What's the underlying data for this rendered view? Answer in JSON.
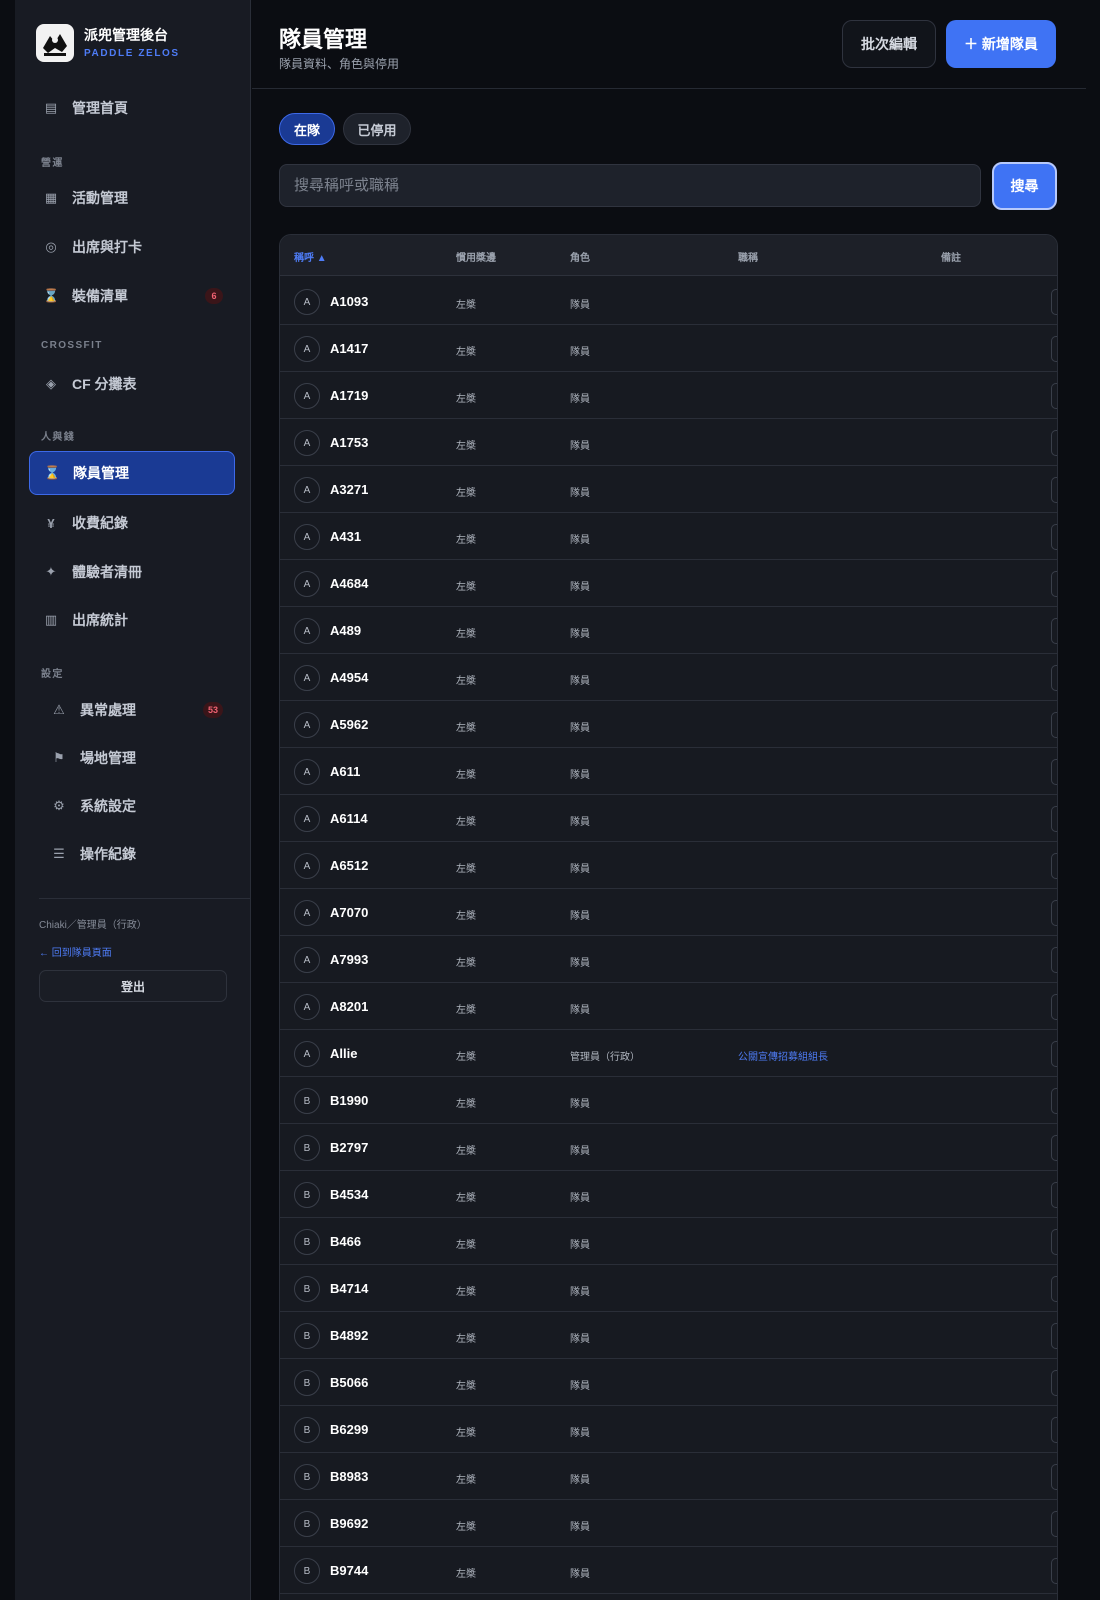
{
  "brand": {
    "title": "派兜管理後台",
    "subtitle": "PADDLE ZELOS"
  },
  "sidebar": {
    "home": {
      "label": "管理首頁",
      "icon": "list-icon"
    },
    "sections": {
      "ops": "營運",
      "crossfit": "CROSSFIT",
      "people": "人與錢",
      "settings": "設定"
    },
    "items": [
      {
        "label": "活動管理",
        "icon": "grid-icon"
      },
      {
        "label": "出席與打卡",
        "icon": "target-icon"
      },
      {
        "label": "裝備清單",
        "icon": "hourglass-icon",
        "badge": "6"
      },
      {
        "label": "CF 分攤表",
        "icon": "diamond-icon"
      },
      {
        "label": "隊員管理",
        "icon": "hourglass-icon"
      },
      {
        "label": "收費紀錄",
        "icon": "yen-icon"
      },
      {
        "label": "體驗者清冊",
        "icon": "sparkle-icon"
      },
      {
        "label": "出席統計",
        "icon": "bars-icon"
      },
      {
        "label": "異常處理",
        "icon": "warning-icon",
        "badge": "53"
      },
      {
        "label": "場地管理",
        "icon": "flag-icon"
      },
      {
        "label": "系統設定",
        "icon": "gear-icon"
      },
      {
        "label": "操作紀錄",
        "icon": "menu-icon"
      }
    ],
    "user": "Chiaki／管理員（行政）",
    "back": "← 回到隊員頁面",
    "logout": "登出"
  },
  "header": {
    "title": "隊員管理",
    "subtitle": "隊員資料、角色與停用",
    "batch_label": "批次編輯",
    "add_label": "＋ 新增隊員"
  },
  "tabs": {
    "active": "在隊",
    "inactive": "已停用"
  },
  "search": {
    "placeholder": "搜尋稱呼或職稱",
    "button": "搜尋"
  },
  "table": {
    "columns": {
      "name": "稱呼 ▲",
      "hand": "慣用槳邊",
      "role": "角色",
      "job": "職稱",
      "note": "備註"
    },
    "rows": [
      {
        "initial": "A",
        "name": "A1093",
        "hand": "左槳",
        "role": "隊員",
        "job": ""
      },
      {
        "initial": "A",
        "name": "A1417",
        "hand": "左槳",
        "role": "隊員",
        "job": ""
      },
      {
        "initial": "A",
        "name": "A1719",
        "hand": "左槳",
        "role": "隊員",
        "job": ""
      },
      {
        "initial": "A",
        "name": "A1753",
        "hand": "左槳",
        "role": "隊員",
        "job": ""
      },
      {
        "initial": "A",
        "name": "A3271",
        "hand": "左槳",
        "role": "隊員",
        "job": ""
      },
      {
        "initial": "A",
        "name": "A431",
        "hand": "左槳",
        "role": "隊員",
        "job": ""
      },
      {
        "initial": "A",
        "name": "A4684",
        "hand": "左槳",
        "role": "隊員",
        "job": ""
      },
      {
        "initial": "A",
        "name": "A489",
        "hand": "左槳",
        "role": "隊員",
        "job": ""
      },
      {
        "initial": "A",
        "name": "A4954",
        "hand": "左槳",
        "role": "隊員",
        "job": ""
      },
      {
        "initial": "A",
        "name": "A5962",
        "hand": "左槳",
        "role": "隊員",
        "job": ""
      },
      {
        "initial": "A",
        "name": "A611",
        "hand": "左槳",
        "role": "隊員",
        "job": ""
      },
      {
        "initial": "A",
        "name": "A6114",
        "hand": "左槳",
        "role": "隊員",
        "job": ""
      },
      {
        "initial": "A",
        "name": "A6512",
        "hand": "左槳",
        "role": "隊員",
        "job": ""
      },
      {
        "initial": "A",
        "name": "A7070",
        "hand": "左槳",
        "role": "隊員",
        "job": ""
      },
      {
        "initial": "A",
        "name": "A7993",
        "hand": "左槳",
        "role": "隊員",
        "job": ""
      },
      {
        "initial": "A",
        "name": "A8201",
        "hand": "左槳",
        "role": "隊員",
        "job": ""
      },
      {
        "initial": "A",
        "name": "Allie",
        "hand": "左槳",
        "role": "管理員（行政）",
        "job": "公關宣傳招募組組長"
      },
      {
        "initial": "B",
        "name": "B1990",
        "hand": "左槳",
        "role": "隊員",
        "job": ""
      },
      {
        "initial": "B",
        "name": "B2797",
        "hand": "左槳",
        "role": "隊員",
        "job": ""
      },
      {
        "initial": "B",
        "name": "B4534",
        "hand": "左槳",
        "role": "隊員",
        "job": ""
      },
      {
        "initial": "B",
        "name": "B466",
        "hand": "左槳",
        "role": "隊員",
        "job": ""
      },
      {
        "initial": "B",
        "name": "B4714",
        "hand": "左槳",
        "role": "隊員",
        "job": ""
      },
      {
        "initial": "B",
        "name": "B4892",
        "hand": "左槳",
        "role": "隊員",
        "job": ""
      },
      {
        "initial": "B",
        "name": "B5066",
        "hand": "左槳",
        "role": "隊員",
        "job": ""
      },
      {
        "initial": "B",
        "name": "B6299",
        "hand": "左槳",
        "role": "隊員",
        "job": ""
      },
      {
        "initial": "B",
        "name": "B8983",
        "hand": "左槳",
        "role": "隊員",
        "job": ""
      },
      {
        "initial": "B",
        "name": "B9692",
        "hand": "左槳",
        "role": "隊員",
        "job": ""
      },
      {
        "initial": "B",
        "name": "B9744",
        "hand": "左槳",
        "role": "隊員",
        "job": ""
      }
    ]
  },
  "colors": {
    "accent": "#3f73f4",
    "active_bg": "#1a3a94",
    "badge_text": "#f06272",
    "link": "#4e7cf6"
  }
}
